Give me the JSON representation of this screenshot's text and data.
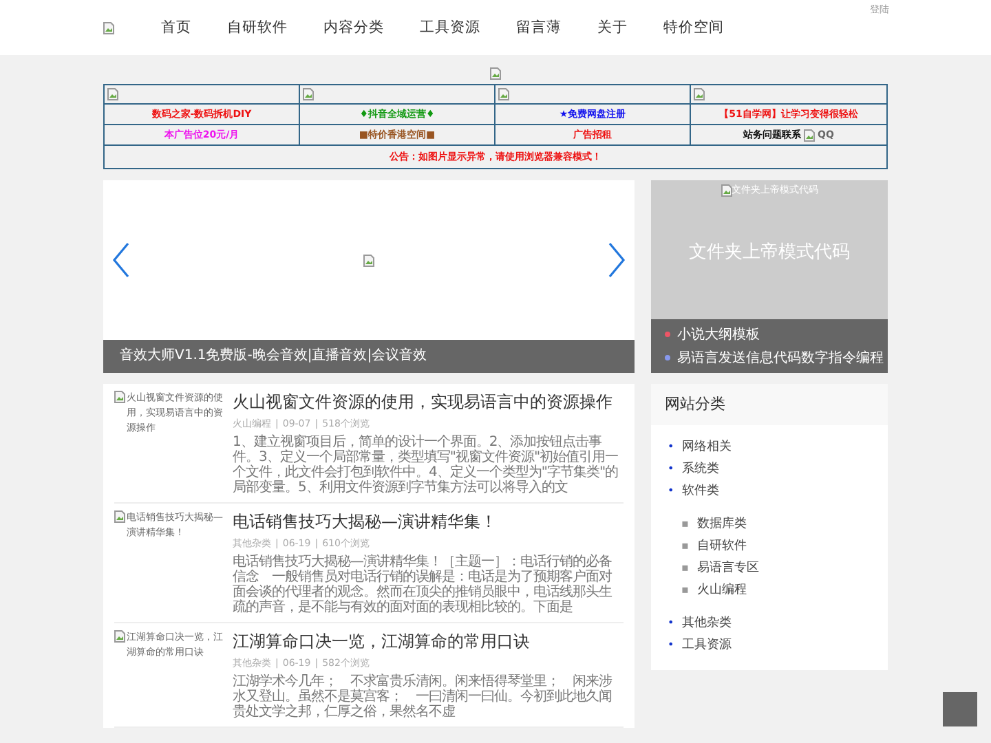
{
  "header": {
    "login": "登陆",
    "nav": [
      "首页",
      "自研软件",
      "内容分类",
      "工具资源",
      "留言薄",
      "关于",
      "特价空间"
    ]
  },
  "ad_table": {
    "rows": [
      {
        "kind": "images",
        "cells": [
          {
            "kind": "image"
          },
          {
            "kind": "image"
          },
          {
            "kind": "image"
          },
          {
            "kind": "image"
          }
        ]
      },
      {
        "kind": "text",
        "cells": [
          {
            "kind": "text",
            "text": "数码之家-数码拆机DIY",
            "color": "#ee1111"
          },
          {
            "kind": "text",
            "text": "♦抖音全域运营♦",
            "color": "#119911"
          },
          {
            "kind": "text",
            "text": "★免费网盘注册",
            "color": "#1111ee"
          },
          {
            "kind": "text",
            "text": "【51自学网】让学习变得很轻松",
            "color": "#ee1111"
          }
        ]
      },
      {
        "kind": "text",
        "cells": [
          {
            "kind": "text",
            "text": "本广告位20元/月",
            "color": "#ee11ee"
          },
          {
            "kind": "text",
            "text": "■特价香港空间■",
            "color": "#995522"
          },
          {
            "kind": "text",
            "text": "广告招租",
            "color": "#ee1111"
          },
          {
            "kind": "contact",
            "text": "站务问题联系",
            "alt": "QQ",
            "color": "#111111"
          }
        ]
      }
    ],
    "notice": "公告：如图片显示异常，请使用浏览器兼容模式！"
  },
  "slider": {
    "caption": "音效大师V1.1免费版-晚会音效|直播音效|会议音效"
  },
  "feature": {
    "image_alt": "文件夹上帝模式代码",
    "title": "文件夹上帝模式代码",
    "links": [
      {
        "text": "小说大纲模板",
        "color": "#ee5566"
      },
      {
        "text": "易语言发送信息代码数字指令编程",
        "color": "#8899ee"
      }
    ]
  },
  "articles": [
    {
      "image_alt": "火山视窗文件资源的使用，实现易语言中的资源操作",
      "title": "火山视窗文件资源的使用，实现易语言中的资源操作",
      "category": "火山编程",
      "date": "09-07",
      "views": "518个浏览",
      "summary": "1、建立视窗项目后，简单的设计一个界面。2、添加按钮点击事件。3、定义一个局部常量，类型填写\"视窗文件资源\"初始值引用一个文件，此文件会打包到软件中。4、定义一个类型为\"字节集类\"的局部变量。5、利用文件资源到字节集方法可以将导入的文"
    },
    {
      "image_alt": "电话销售技巧大揭秘—演讲精华集！",
      "title": "电话销售技巧大揭秘—演讲精华集！",
      "category": "其他杂类",
      "date": "06-19",
      "views": "610个浏览",
      "summary": "电话销售技巧大揭秘—演讲精华集！［主题一］：电话行销的必备信念　一般销售员对电话行销的误解是：电话是为了预期客户面对面会谈的代理者的观念。然而在顶尖的推销员眼中，电话线那头生疏的声音，是不能与有效的面对面的表现相比较的。下面是"
    },
    {
      "image_alt": "江湖算命口决一览，江湖算命的常用口诀",
      "title": "江湖算命口决一览，江湖算命的常用口诀",
      "category": "其他杂类",
      "date": "06-19",
      "views": "582个浏览",
      "summary": "江湖学术今几年；　不求富贵乐清闲。闲来悟得琴堂里；　闲来涉水又登山。虽然不是莫宫客；　一曰清闲一曰仙。今初到此地久闻贵处文学之邦，仁厚之俗，果然名不虚"
    }
  ],
  "sidebar": {
    "title": "网站分类",
    "items": [
      {
        "text": "网络相关"
      },
      {
        "text": "系统类"
      },
      {
        "text": "软件类",
        "children": [
          {
            "text": "数据库类"
          },
          {
            "text": "自研软件"
          },
          {
            "text": "易语言专区"
          },
          {
            "text": "火山编程"
          }
        ]
      },
      {
        "text": "其他杂类"
      },
      {
        "text": "工具资源"
      }
    ],
    "bullet": "•",
    "sub_bullet": "▪"
  },
  "meta_separator": "|"
}
